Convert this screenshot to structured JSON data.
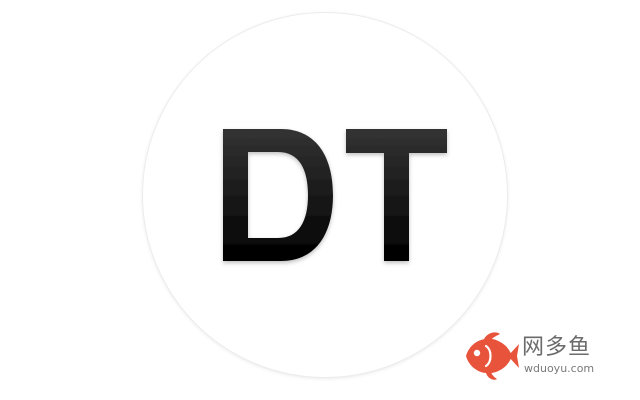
{
  "logo": {
    "text": "DT",
    "letter_color_top": "#333333",
    "letter_color_bottom": "#000000",
    "circle_color": "#ffffff"
  },
  "watermark": {
    "name": "网多鱼",
    "domain": "wduoyu.com",
    "icon": "fish-icon",
    "accent": "#e8533b"
  }
}
